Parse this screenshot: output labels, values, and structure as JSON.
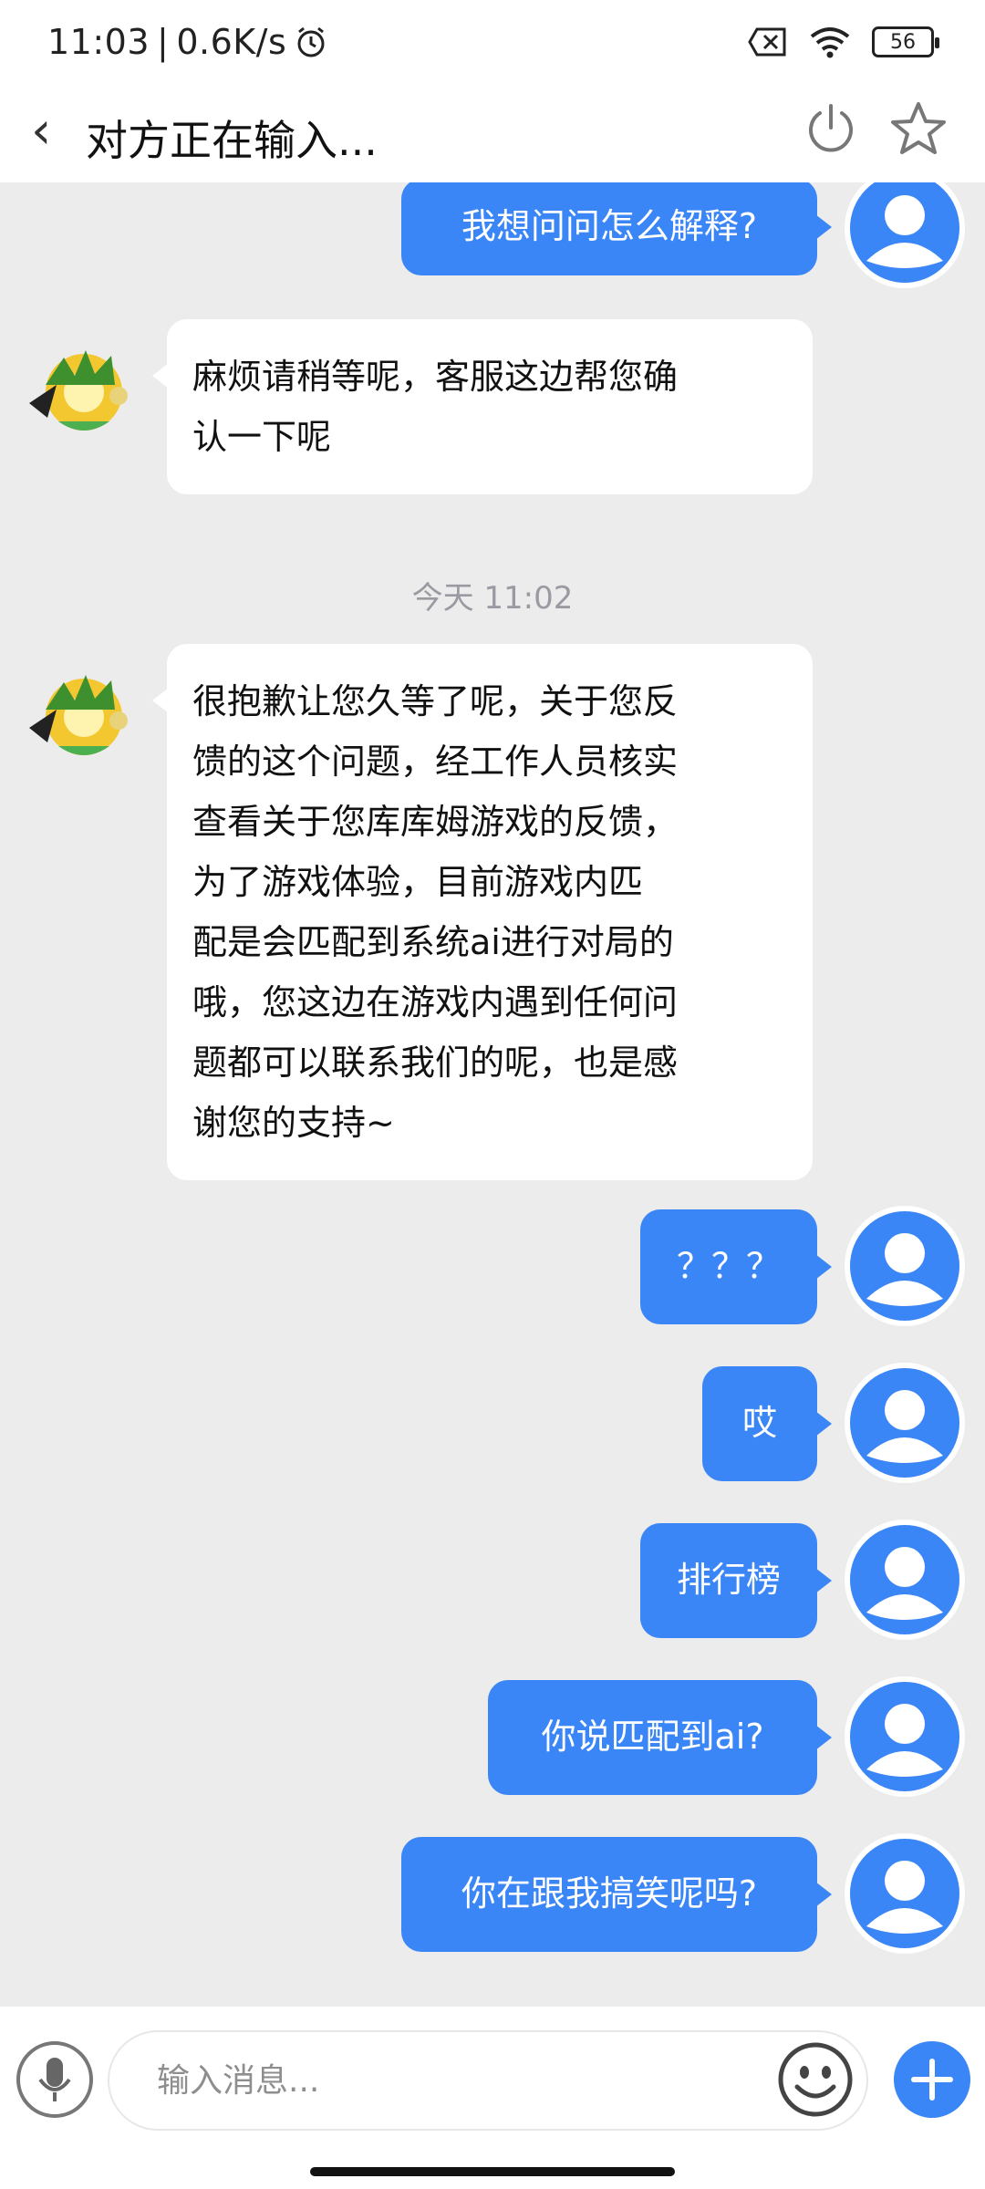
{
  "status_bar": {
    "time": "11:03",
    "net_speed": "0.6K/s",
    "battery": "56",
    "icons": [
      "alarm-icon",
      "sim-off-icon",
      "wifi-icon",
      "battery-icon"
    ]
  },
  "header": {
    "back_icon": "chevron-left-icon",
    "title": "对方正在输入...",
    "actions": [
      "power-icon",
      "star-icon"
    ]
  },
  "theme": {
    "accent": "#3b86f6",
    "background": "#ececec",
    "bubble_in": "#ffffff"
  },
  "messages": [
    {
      "from": "me",
      "text": "我想问问怎么解释?"
    },
    {
      "from": "agent",
      "lines": [
        "麻烦请稍等呢，客服这边帮您确",
        "认一下呢"
      ]
    },
    {
      "separator": "今天 11:02"
    },
    {
      "from": "agent",
      "lines": [
        "很抱歉让您久等了呢，关于您反",
        "馈的这个问题，经工作人员核实",
        "查看关于您库库姆游戏的反馈，",
        "为了游戏体验，目前游戏内匹",
        "配是会匹配到系统ai进行对局的",
        "哦，您这边在游戏内遇到任何问",
        "题都可以联系我们的呢，也是感",
        "谢您的支持~"
      ]
    },
    {
      "from": "me",
      "text": "？？？"
    },
    {
      "from": "me",
      "text": "哎"
    },
    {
      "from": "me",
      "text": "排行榜"
    },
    {
      "from": "me",
      "text": "你说匹配到ai?"
    },
    {
      "from": "me",
      "text": "你在跟我搞笑呢吗?"
    }
  ],
  "input": {
    "placeholder": "输入消息...",
    "value": "",
    "icons": [
      "microphone-icon",
      "emoji-icon",
      "plus-icon"
    ]
  }
}
